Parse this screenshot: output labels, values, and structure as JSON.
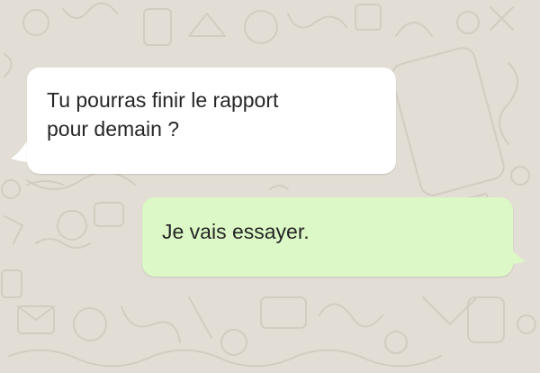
{
  "conversation": {
    "messages": [
      {
        "direction": "incoming",
        "text": "Tu pourras finir le rapport\npour demain ?"
      },
      {
        "direction": "outgoing",
        "text": "Je vais essayer."
      }
    ]
  },
  "colors": {
    "background": "#e3ded5",
    "incoming_bubble": "#ffffff",
    "outgoing_bubble": "#dcf8c6",
    "doodle": "#cfc9bd"
  },
  "background_icons": [
    "doodle-pattern-icon"
  ]
}
